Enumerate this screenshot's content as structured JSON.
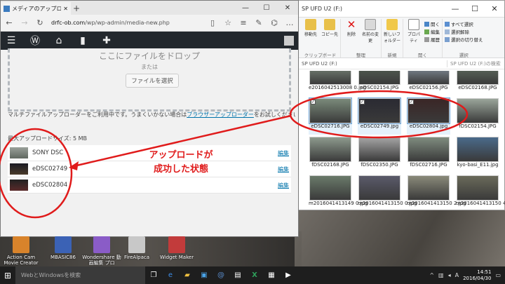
{
  "browser": {
    "tab_title": "メディアのアップロード・DRF",
    "url_domain": "drfc-ob.com",
    "url_path": "/wp/wp-admin/media-new.php",
    "win_minimize": "—",
    "win_maximize": "☐",
    "win_close": "✕"
  },
  "wp_admin_bar": {
    "menu_icon": "☰",
    "wp_logo_icon": "Ⓦ",
    "home_icon": "⌂",
    "comment_icon": "▮",
    "new_icon": "✚"
  },
  "upload": {
    "drop_title": "ここにファイルをドロップ",
    "or_text": "または",
    "select_button": "ファイルを選択",
    "multi_text_before": "マルチファイルアップローダーをご利用中です。うまくいかない場合は",
    "multi_link": "ブラウザーアップローダー",
    "multi_text_after": "をお試しください。",
    "max_size": "最大アップロードサイズ: 5 MB",
    "items": [
      {
        "name": "SONY DSC",
        "edit": "編集"
      },
      {
        "name": "eDSC02749",
        "edit": "編集"
      },
      {
        "name": "eDSC02804",
        "edit": "編集"
      }
    ]
  },
  "annotation": {
    "line1": "アップロードが",
    "line2": "成功した状態",
    "color": "#e01b1b"
  },
  "explorer": {
    "title": "SP UFD U2 (F:)",
    "ribbon": {
      "clipboard": {
        "label": "クリップボード",
        "items": [
          "移動先",
          "コピー先"
        ]
      },
      "organize": {
        "label": "整理",
        "items": [
          "削除",
          "名前の変更"
        ]
      },
      "new": {
        "label": "新規",
        "items": [
          "新しいフォルダー"
        ]
      },
      "open": {
        "label": "開く",
        "items": [
          "プロパティ"
        ],
        "list": [
          "開く",
          "編集",
          "履歴"
        ]
      },
      "select": {
        "label": "選択",
        "list": [
          "すべて選択",
          "選択解除",
          "選択の切り替え"
        ]
      }
    },
    "address": "SP UFD U2 (F:)",
    "search_placeholder": "SP UFD U2 (F:)の検索",
    "files": [
      {
        "name": "e2016042513008 0.jpg",
        "selected": false
      },
      {
        "name": "eDSC02154.JPG",
        "selected": false
      },
      {
        "name": "eDSC02156.JPG",
        "selected": false
      },
      {
        "name": "eDSC02168.JPG",
        "selected": false
      },
      {
        "name": "eDSC02716.JPG",
        "selected": true
      },
      {
        "name": "eDSC02749.jpg",
        "selected": true
      },
      {
        "name": "eDSC02804.jpg",
        "selected": true
      },
      {
        "name": "fDSC02154.JPG",
        "selected": false
      },
      {
        "name": "fDSC02168.JPG",
        "selected": false
      },
      {
        "name": "fDSC02350.JPG",
        "selected": false
      },
      {
        "name": "fDSC02716.JPG",
        "selected": false
      },
      {
        "name": "kyo-basi_E11.jpg",
        "selected": false
      },
      {
        "name": "m2016041413149 0.jpg",
        "selected": false
      },
      {
        "name": "m2016041413150 0.jpg",
        "selected": false
      },
      {
        "name": "m2016041413150 2.jpg",
        "selected": false
      },
      {
        "name": "m2016041413150 4.jpg",
        "selected": false
      }
    ]
  },
  "desktop_icons": [
    {
      "label": "Action Cam Movie Creator",
      "color": "#d8832b"
    },
    {
      "label": "MBASIC86",
      "color": "#3b62b5"
    },
    {
      "label": "Wondershare 動画編集 プロ",
      "color": "#8a5cc7"
    },
    {
      "label": "FireAlpaca",
      "color": "#c8c8c8"
    },
    {
      "label": "Widget Maker",
      "color": "#c23b3b"
    }
  ],
  "taskbar": {
    "search_placeholder": "WebとWindowsを検索",
    "time": "14:51",
    "date": "2016/04/30",
    "tray_arrow": "^",
    "ime": "A"
  }
}
